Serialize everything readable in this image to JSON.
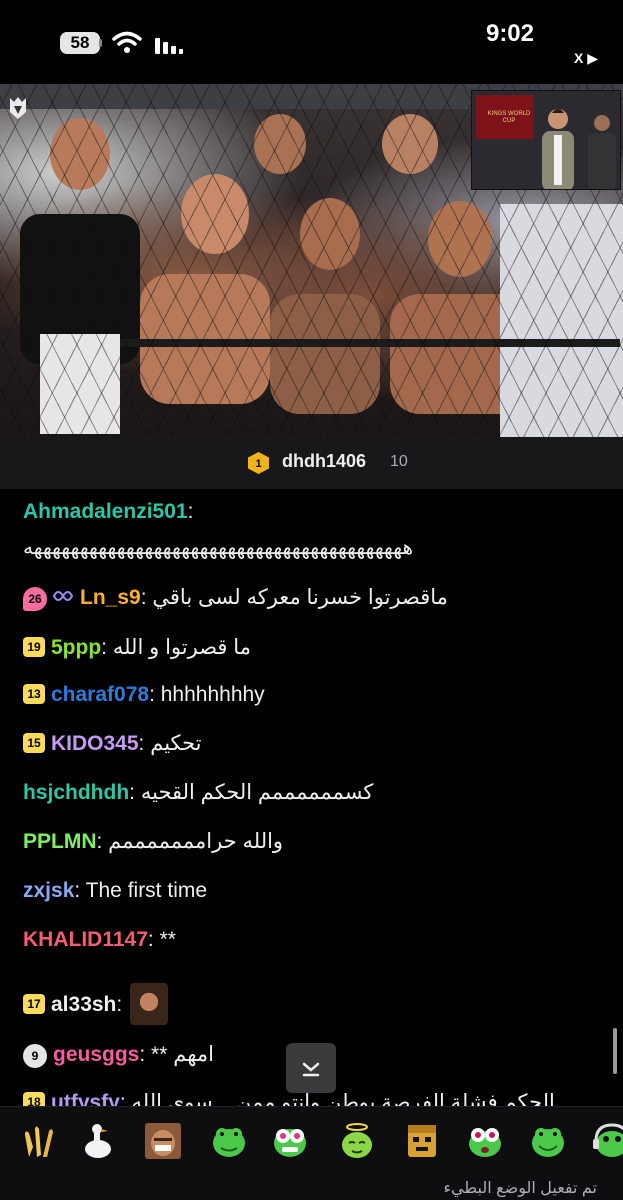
{
  "status_bar": {
    "battery": "58",
    "time": "9:02",
    "back_app": "X ▶"
  },
  "video": {
    "pip_stage_text": "KINGS WORLD CUP"
  },
  "viewer_strip": {
    "badge_number": "1",
    "username": "dhdh1406",
    "count": "10"
  },
  "chat": {
    "messages": [
      {
        "user": "Ahmadalenzi501",
        "color": "#2fc5a7",
        "text": "هههههههههههههههههههههههههههههههههههههههههه"
      },
      {
        "badge": "26",
        "user": "Ln_s9",
        "color": "#ffb031",
        "text": "ماقصرتوا خسرنا معركه لسى باقي"
      },
      {
        "badge": "19",
        "user": "5ppp",
        "color": "#8ae234",
        "text": "ما قصرتوا و الله"
      },
      {
        "badge": "13",
        "user": "charaf078",
        "color": "#2e7bd8",
        "text": "hhhhhhhhy"
      },
      {
        "badge": "15",
        "user": "KIDO345",
        "color": "#c69bf5",
        "text": "تحكيم"
      },
      {
        "user": "hsjchdhdh",
        "color": "#2fc5a7",
        "text": "كسممممممم الحكم القحيه"
      },
      {
        "user": "PPLMN",
        "color": "#7ef062",
        "text": "والله حرامممممممم"
      },
      {
        "user": "zxjsk",
        "color": "#8aa8f0",
        "text": "The first time"
      },
      {
        "user": "KHALID1147",
        "color": "#f35e73",
        "text": "**"
      },
      {
        "badge": "17",
        "user": "al33sh",
        "color": "#efeff1",
        "text": ""
      },
      {
        "badge": "9",
        "user": "geusggs",
        "color": "#f35e9e",
        "text": "** امهم"
      },
      {
        "badge": "18",
        "user": "utfysfy",
        "color": "#b69bf5",
        "text": "الحكم فشلة الفرصة يوطن وانتو ممن ...سوى الله"
      }
    ]
  },
  "emote_bar": {
    "emotes": [
      "clap-hands-emote",
      "goose-emote",
      "laughing-man-emote",
      "frog-emote",
      "frog-dizzy-emote",
      "halo-emote",
      "box-face-emote",
      "frog-shocked-emote",
      "frog-smile-emote",
      "frog-headphones-emote"
    ]
  },
  "footer": {
    "text": "تم تفعيل الوضع البطيء"
  },
  "colors": {
    "background": "#000000",
    "panel": "#18181b",
    "badge_yellow": "#fadb5c"
  }
}
